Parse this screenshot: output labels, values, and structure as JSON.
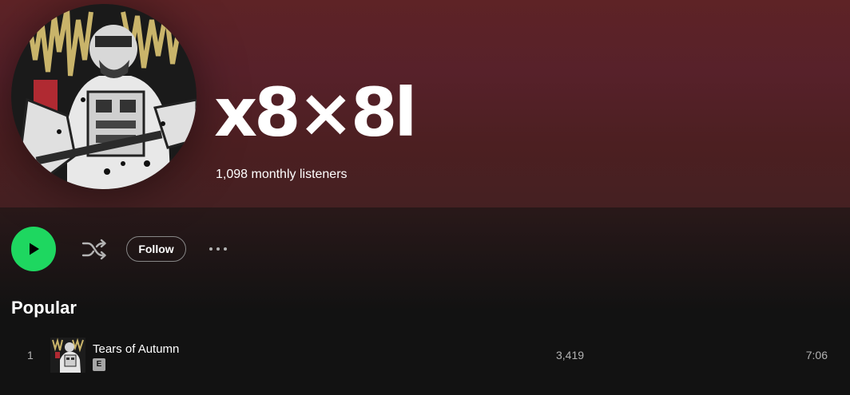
{
  "artist": {
    "name": "x8×8l",
    "monthly_listeners": "1,098 monthly listeners"
  },
  "actions": {
    "follow_label": "Follow"
  },
  "icons": {
    "play": "play-icon",
    "shuffle": "shuffle-icon",
    "more": "more-options-icon",
    "explicit": "explicit-badge"
  },
  "colors": {
    "header_bg": "#5e2326",
    "play_button": "#1ed760",
    "background": "#121212",
    "secondary_text": "#b3b3b3"
  },
  "popular": {
    "title": "Popular",
    "tracks": [
      {
        "number": "1",
        "title": "Tears of Autumn",
        "explicit_label": "E",
        "plays": "3,419",
        "duration": "7:06"
      }
    ]
  }
}
